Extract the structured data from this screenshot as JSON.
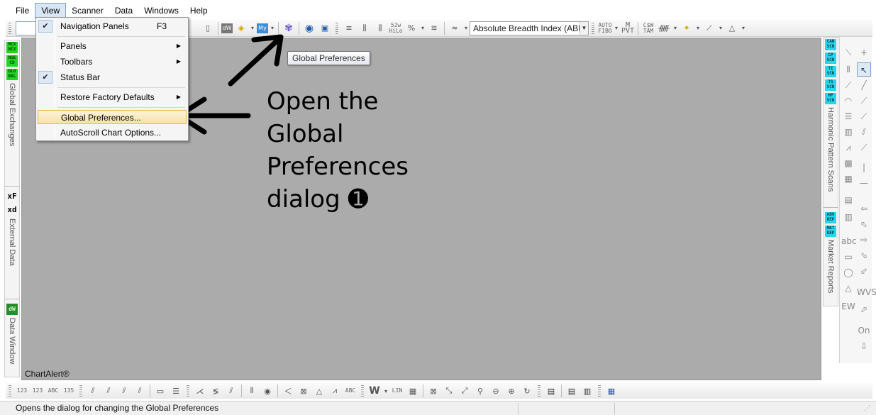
{
  "menubar": {
    "items": [
      "File",
      "View",
      "Scanner",
      "Data",
      "Windows",
      "Help"
    ]
  },
  "view_menu": {
    "items": [
      {
        "label": "Navigation Panels",
        "shortcut": "F3",
        "checked": true
      },
      {
        "label": "Panels",
        "submenu": true
      },
      {
        "label": "Toolbars",
        "submenu": true
      },
      {
        "label": "Status Bar",
        "checked": true
      },
      {
        "label": "Restore Factory Defaults",
        "submenu": true
      },
      {
        "label": "Global Preferences...",
        "highlighted": true
      },
      {
        "label": "AutoScroll Chart Options..."
      }
    ]
  },
  "toolbar": {
    "indicator_select_value": "Absolute Breadth Index (ABI",
    "tooltip": "Global Preferences"
  },
  "left_panel": {
    "badges": [
      "MCX NCX",
      "NSE CD",
      "GLO BAL"
    ],
    "label_global": "Global Exchanges",
    "fx_icon": "xF",
    "xd_icon": "xd",
    "label_external": "External Data",
    "dw_icon": "dW",
    "label_datawindow": "Data Window"
  },
  "right_panel": {
    "badges": [
      "CAN SCN",
      "CP SCN",
      "TI SCN",
      "TS SCN",
      "HP SCN"
    ],
    "label_harmonic": "Harmonic Pattern Scans",
    "report_badges": [
      "ADV REP",
      "MKT REP"
    ],
    "label_market": "Market Reports",
    "tool_on": "On"
  },
  "annotation": {
    "lines": [
      "Open the",
      "Global",
      "Preferences",
      "dialog ➊"
    ]
  },
  "chart": {
    "watermark": "ChartAlert®"
  },
  "statusbar": {
    "text": "Opens the dialog for changing the Global Preferences"
  },
  "colors": {
    "chart_bg": "#ababab",
    "menu_highlight": "#f7e2a9",
    "badge_green": "#23d423",
    "badge_teal": "#28d7e5"
  }
}
